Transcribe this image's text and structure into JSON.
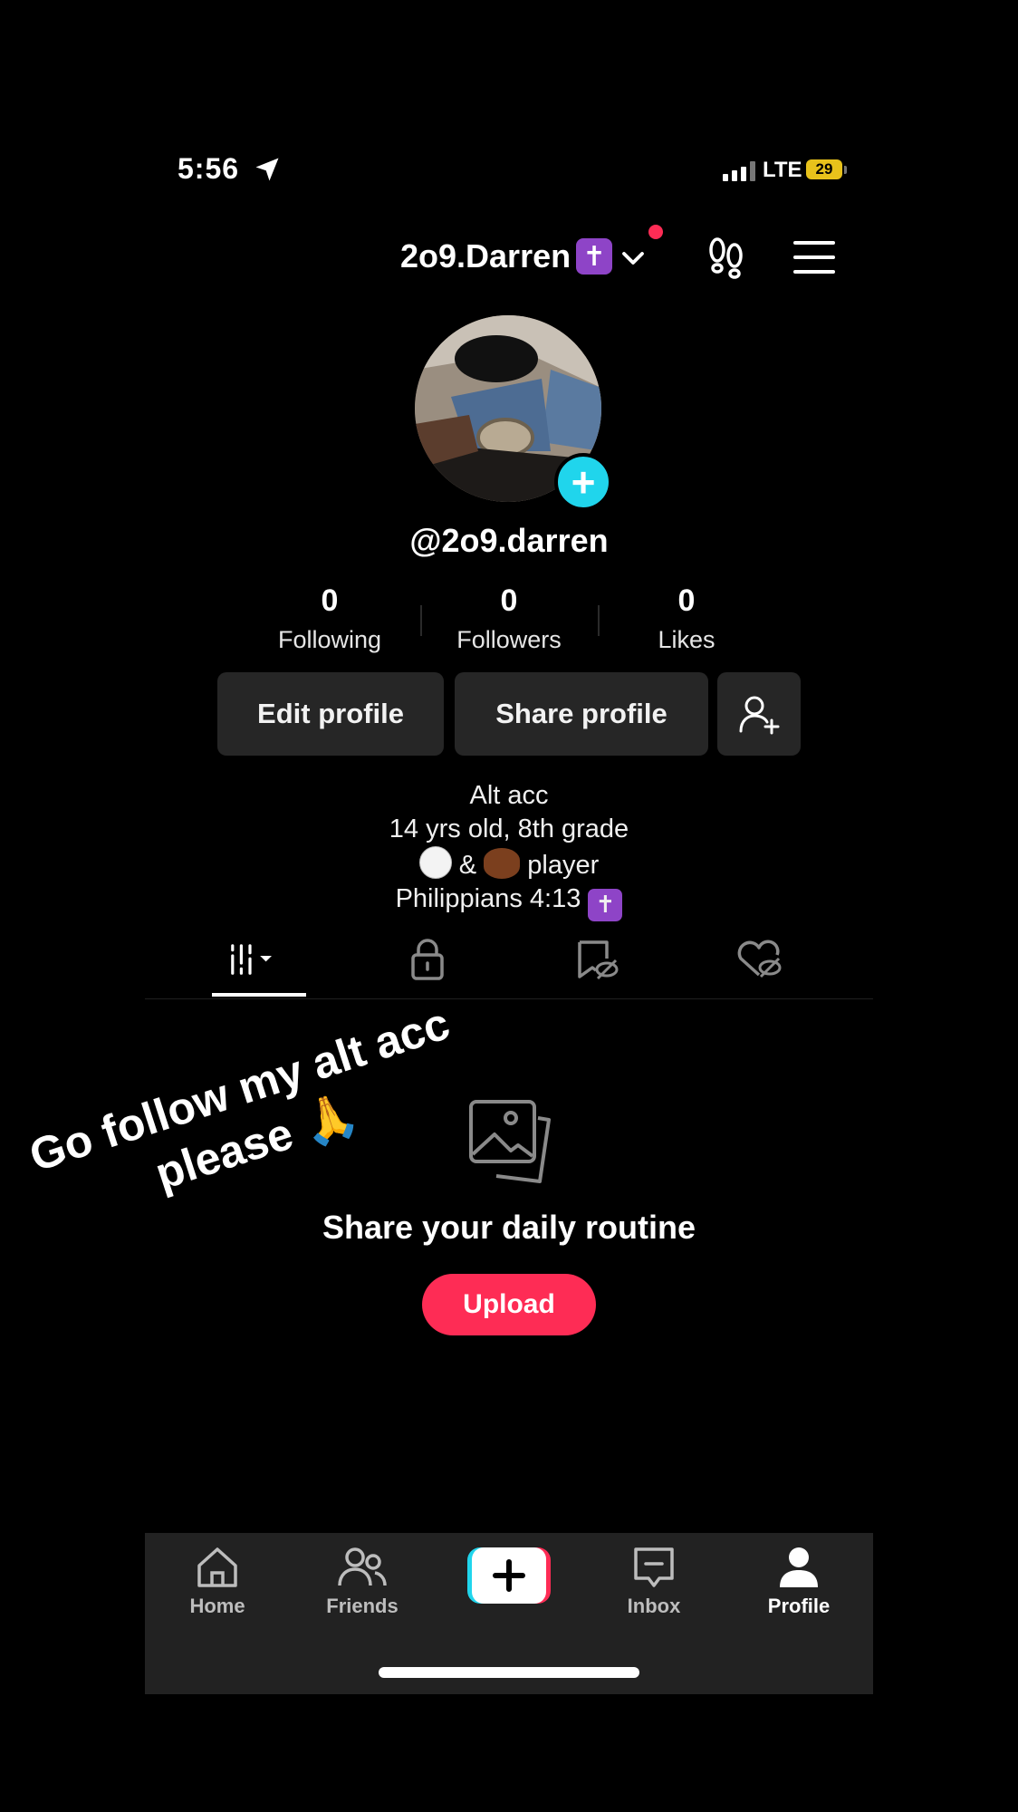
{
  "status_bar": {
    "time": "5:56",
    "network": "LTE",
    "battery": "29"
  },
  "header": {
    "display_name": "2o9.Darren",
    "cross_emoji": "✝"
  },
  "profile": {
    "handle": "@2o9.darren",
    "stats": [
      {
        "value": "0",
        "label": "Following"
      },
      {
        "value": "0",
        "label": "Followers"
      },
      {
        "value": "0",
        "label": "Likes"
      }
    ],
    "buttons": {
      "edit": "Edit profile",
      "share": "Share profile"
    },
    "bio": {
      "line1": "Alt acc",
      "line2": "14 yrs old, 8th grade",
      "line3_mid": "&",
      "line3_end": "player",
      "line4": "Philippians 4:13"
    }
  },
  "overlay_caption": "Go follow my alt acc please 🙏",
  "empty_state": {
    "title": "Share your daily routine",
    "upload": "Upload"
  },
  "bottom_nav": {
    "home": "Home",
    "friends": "Friends",
    "inbox": "Inbox",
    "profile": "Profile"
  },
  "colors": {
    "accent": "#fe2c55",
    "cyan": "#20d5ec",
    "cross_purple": "#8e44c7",
    "battery": "#e8c21b"
  }
}
